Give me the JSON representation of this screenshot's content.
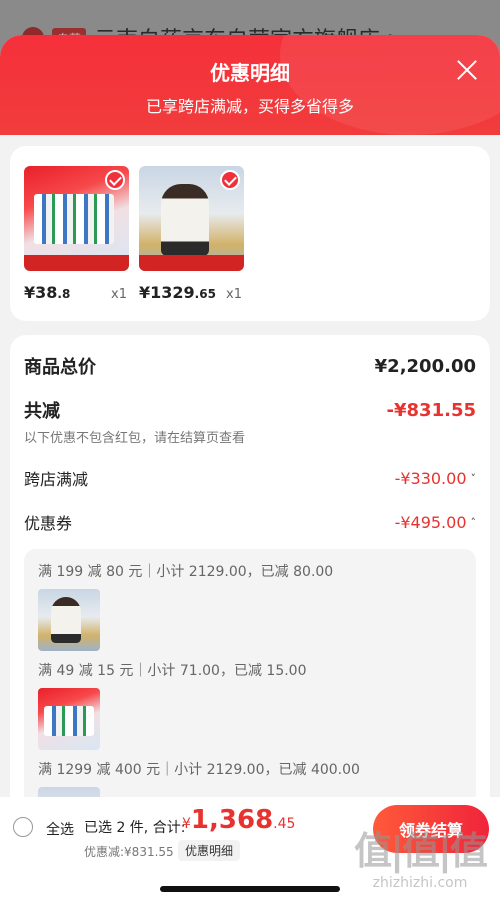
{
  "background": {
    "store_tag": "自营",
    "store_name": "云南白药京东自营官方旗舰店 >"
  },
  "sheet": {
    "title": "优惠明细",
    "subtitle": "已享跨店满减，买得多省得多"
  },
  "products": [
    {
      "price_main": "¥38",
      "price_cents": ".8",
      "qty": "x1",
      "image": "toothpaste-bundle"
    },
    {
      "price_main": "¥1329",
      "price_cents": ".65",
      "qty": "x1",
      "image": "down-jacket-model"
    }
  ],
  "summary": {
    "total_label": "商品总价",
    "total_value": "¥2,200.00",
    "minus_label": "共减",
    "minus_value": "-¥831.55",
    "note": "以下优惠不包含红包，请在结算页查看",
    "items": [
      {
        "label": "跨店满减",
        "value": "-¥330.00",
        "chevron": "˅"
      },
      {
        "label": "优惠券",
        "value": "-¥495.00",
        "chevron": "˄"
      }
    ]
  },
  "coupons": [
    {
      "text": "满 199 减 80 元｜小计 2129.00，已减 80.00",
      "image": "down-jacket-model"
    },
    {
      "text": "满 49 减 15 元｜小计 71.00，已减 15.00",
      "image": "toothpaste-bundle"
    },
    {
      "text": "满 1299 减 400 元｜小计 2129.00，已减 400.00",
      "image": "down-jacket-model"
    }
  ],
  "bottom_bar": {
    "select_all": "全选",
    "chosen": "已选 2 件, 合计:",
    "total_currency": "¥",
    "total_main": "1,368",
    "total_cents": ".45",
    "discount_note": "优惠减:¥831.55",
    "detail_link": "优惠明细",
    "checkout": "领券结算"
  },
  "watermark": {
    "logo": "值|值|值",
    "url": "zhizhizhi.com"
  },
  "colors": {
    "accent": "#F0303A",
    "price_red": "#E8322F",
    "sheet_bg": "#F2F2F2"
  }
}
